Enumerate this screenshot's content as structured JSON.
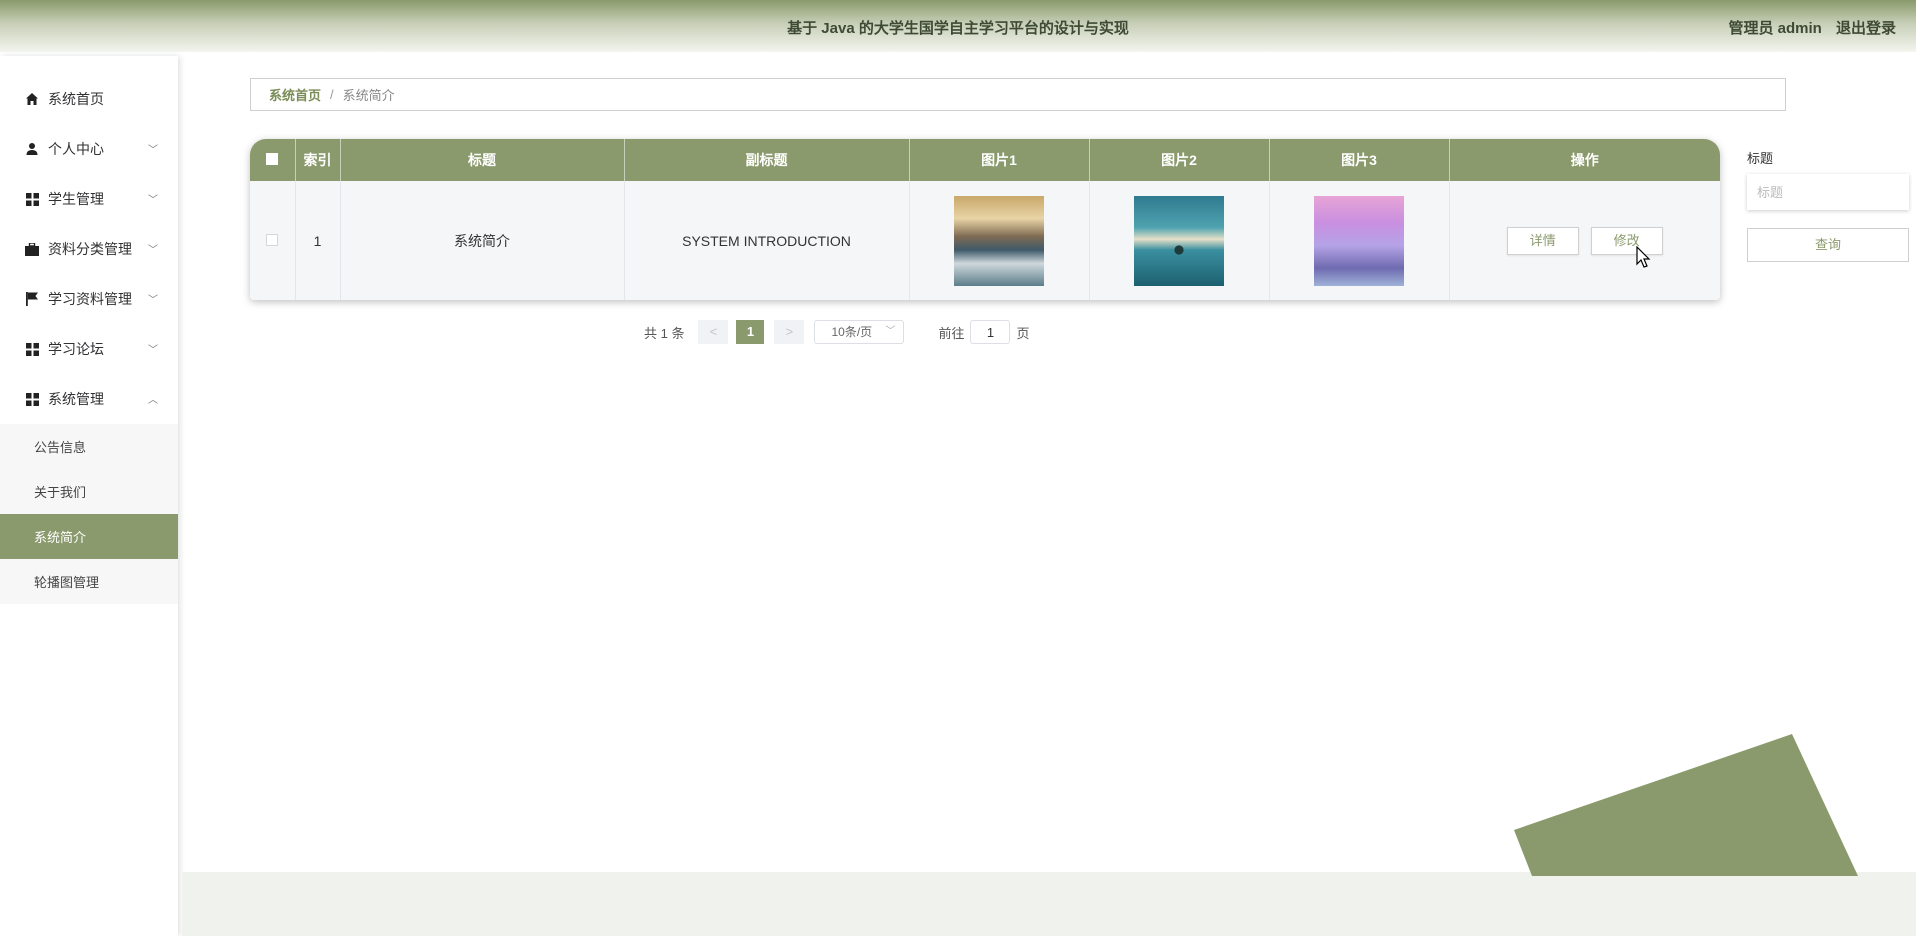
{
  "header": {
    "title": "基于 Java 的大学生国学自主学习平台的设计与实现",
    "user": "管理员 admin",
    "logout": "退出登录"
  },
  "sidebar": {
    "items": [
      {
        "label": "系统首页",
        "icon": "home-icon"
      },
      {
        "label": "个人中心",
        "icon": "user-icon",
        "chevron": "﹀"
      },
      {
        "label": "学生管理",
        "icon": "grid-icon",
        "chevron": "﹀"
      },
      {
        "label": "资料分类管理",
        "icon": "briefcase-icon",
        "chevron": "﹀"
      },
      {
        "label": "学习资料管理",
        "icon": "flag-icon",
        "chevron": "﹀"
      },
      {
        "label": "学习论坛",
        "icon": "grid-icon",
        "chevron": "﹀"
      },
      {
        "label": "系统管理",
        "icon": "grid-icon",
        "chevron": "︿"
      }
    ],
    "subitems": [
      {
        "label": "公告信息"
      },
      {
        "label": "关于我们"
      },
      {
        "label": "系统简介",
        "active": true
      },
      {
        "label": "轮播图管理"
      }
    ]
  },
  "breadcrumb": {
    "home": "系统首页",
    "separator": "/",
    "current": "系统简介"
  },
  "table": {
    "headers": [
      "索引",
      "标题",
      "副标题",
      "图片1",
      "图片2",
      "图片3",
      "操作"
    ],
    "rows": [
      {
        "index": "1",
        "title": "系统简介",
        "subtitle": "SYSTEM INTRODUCTION",
        "detail": "详情",
        "edit": "修改"
      }
    ]
  },
  "search": {
    "label": "标题",
    "placeholder": "标题",
    "button": "查询"
  },
  "pagination": {
    "total": "共 1 条",
    "prev": "<",
    "current": "1",
    "next": ">",
    "page_size": "10条/页",
    "goto_label": "前往",
    "goto_value": "1",
    "page_suffix": "页"
  },
  "colors": {
    "accent": "#8a9a6c",
    "header_text": "#3e4a35",
    "band": "#f0f2ed"
  }
}
